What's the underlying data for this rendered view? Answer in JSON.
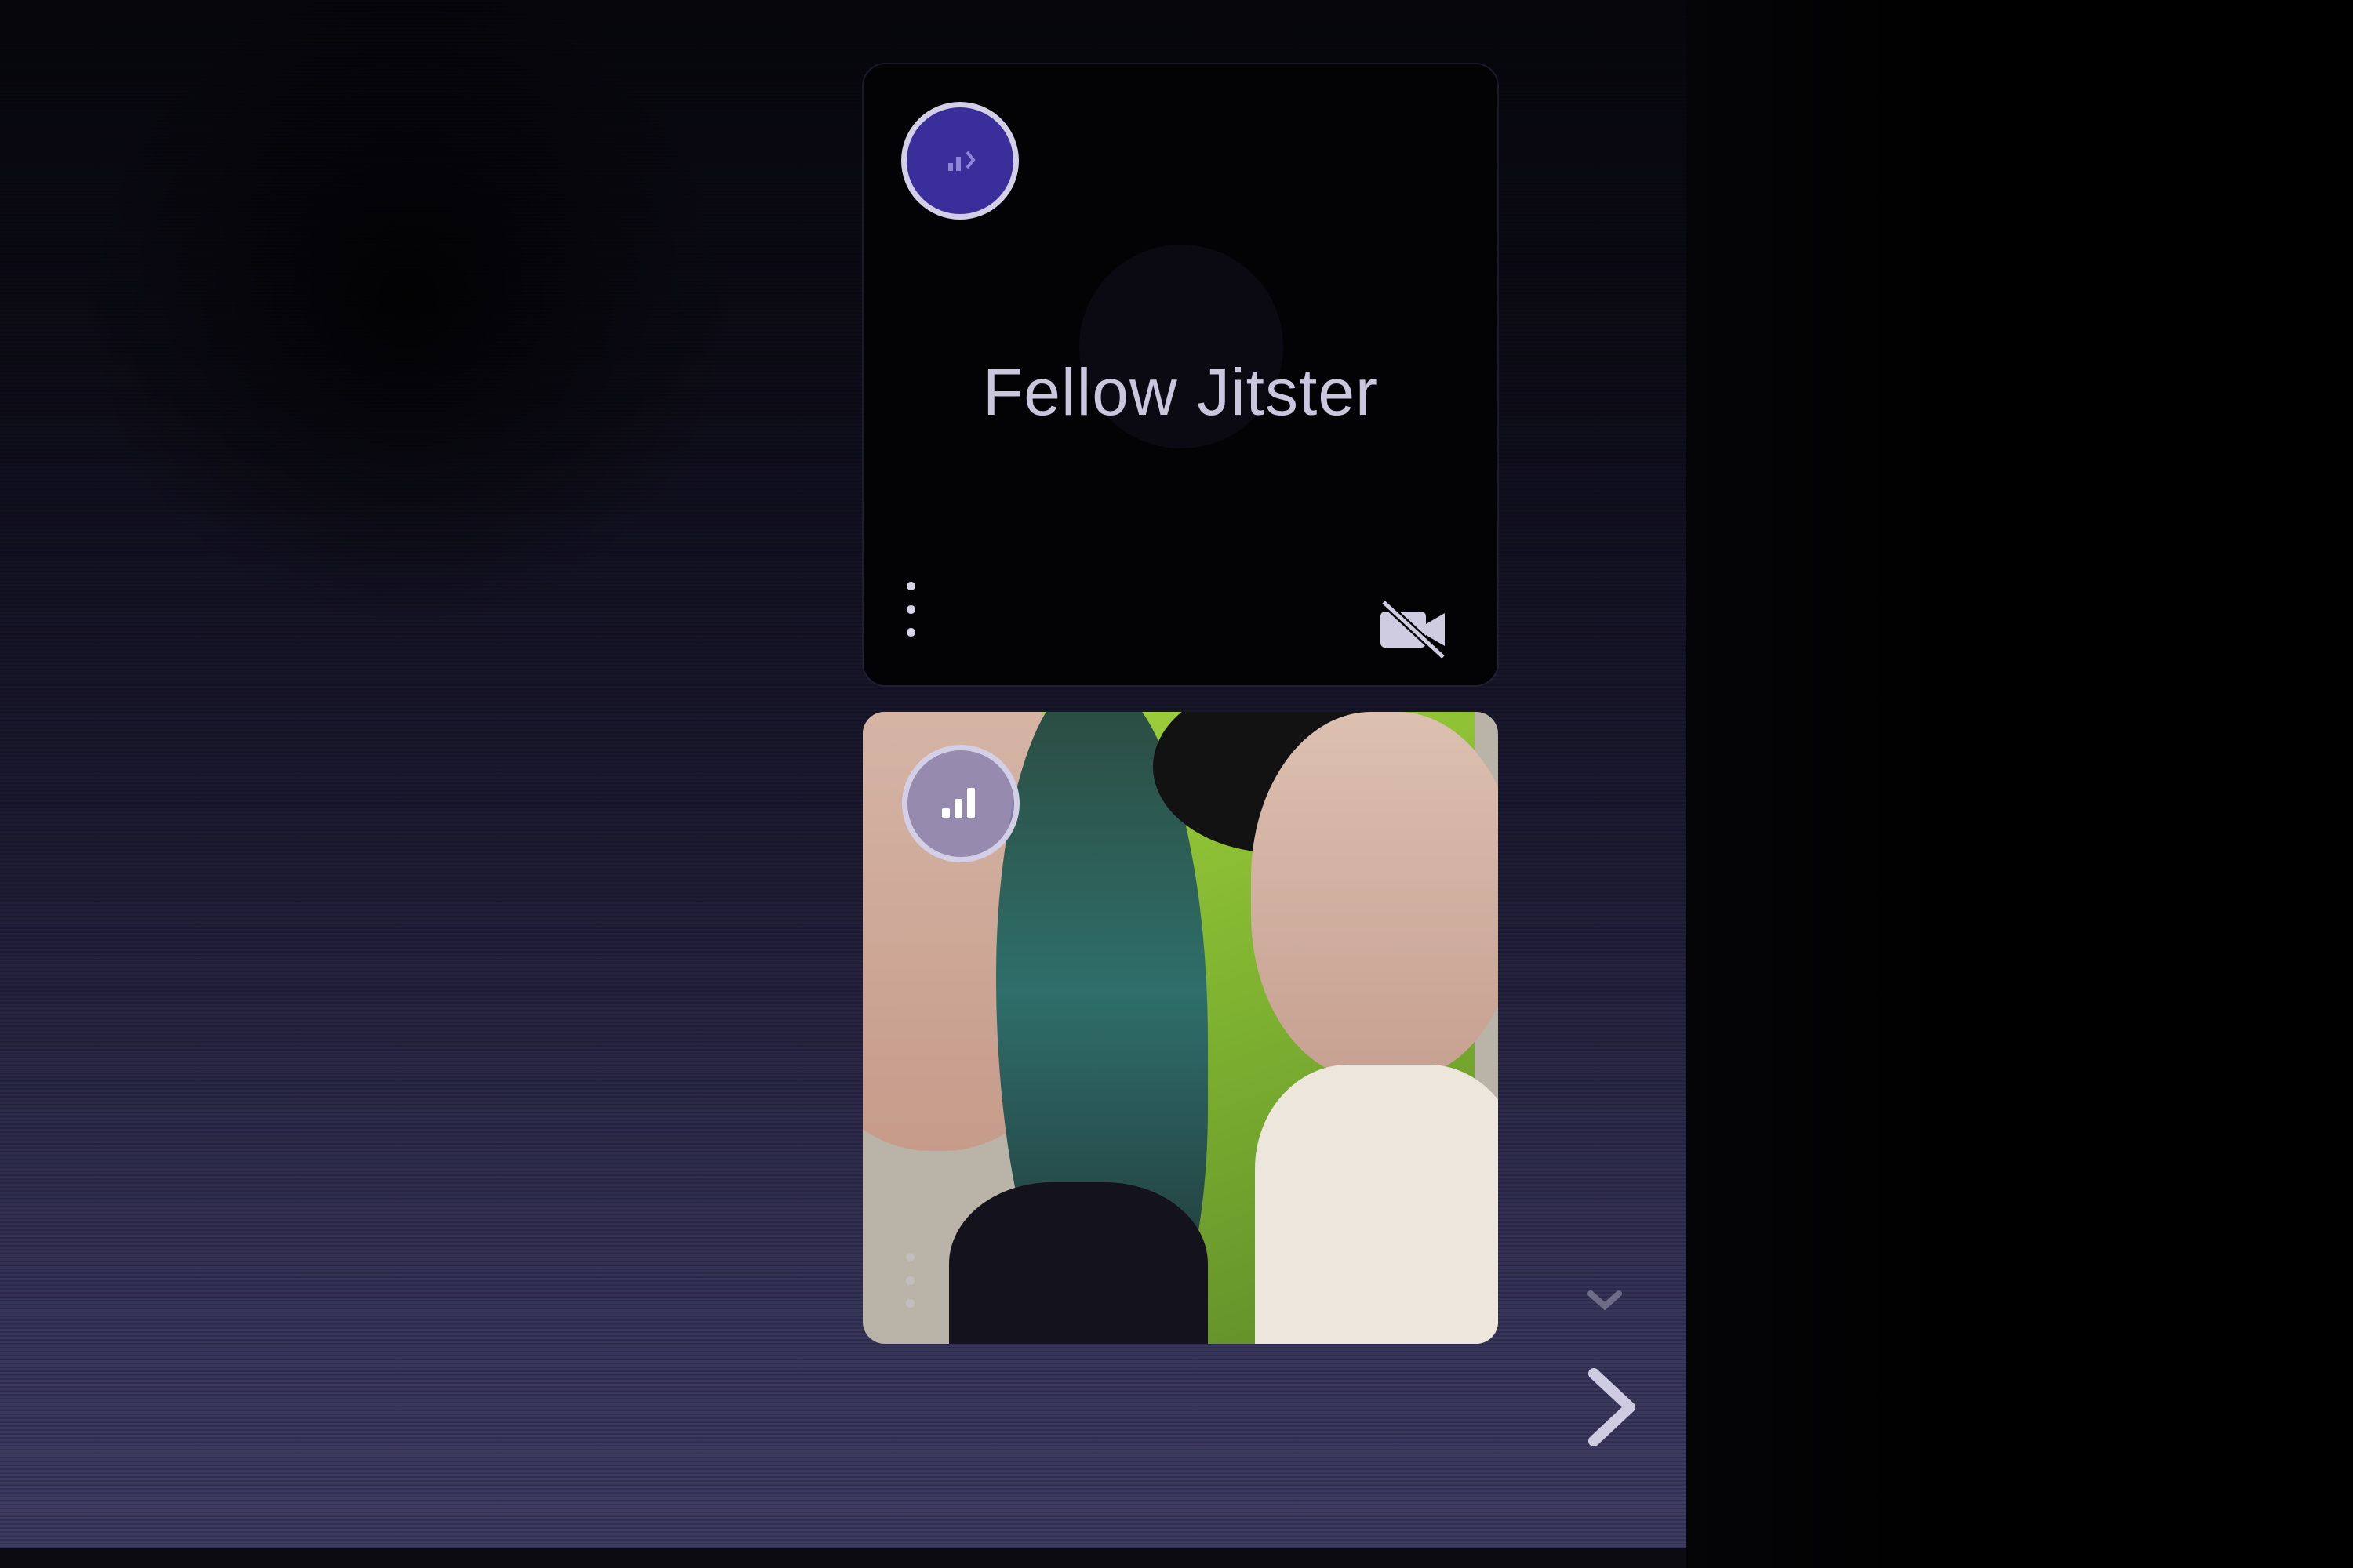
{
  "filmstrip": {
    "tiles": [
      {
        "display_name": "Fellow Jitster",
        "indicator_icon": "audio-level-icon",
        "menu_icon": "more-options-icon",
        "status_icon": "video-off-icon"
      },
      {
        "display_name": "",
        "indicator_icon": "connection-quality-icon",
        "menu_icon": "more-options-icon"
      }
    ]
  },
  "navigation": {
    "scroll_icon": "chevron-down-icon",
    "next_icon": "chevron-right-icon"
  },
  "colors": {
    "accent": "#3a2e9a",
    "indicator_border": "#d3cfe6",
    "text": "#c9c6de"
  }
}
